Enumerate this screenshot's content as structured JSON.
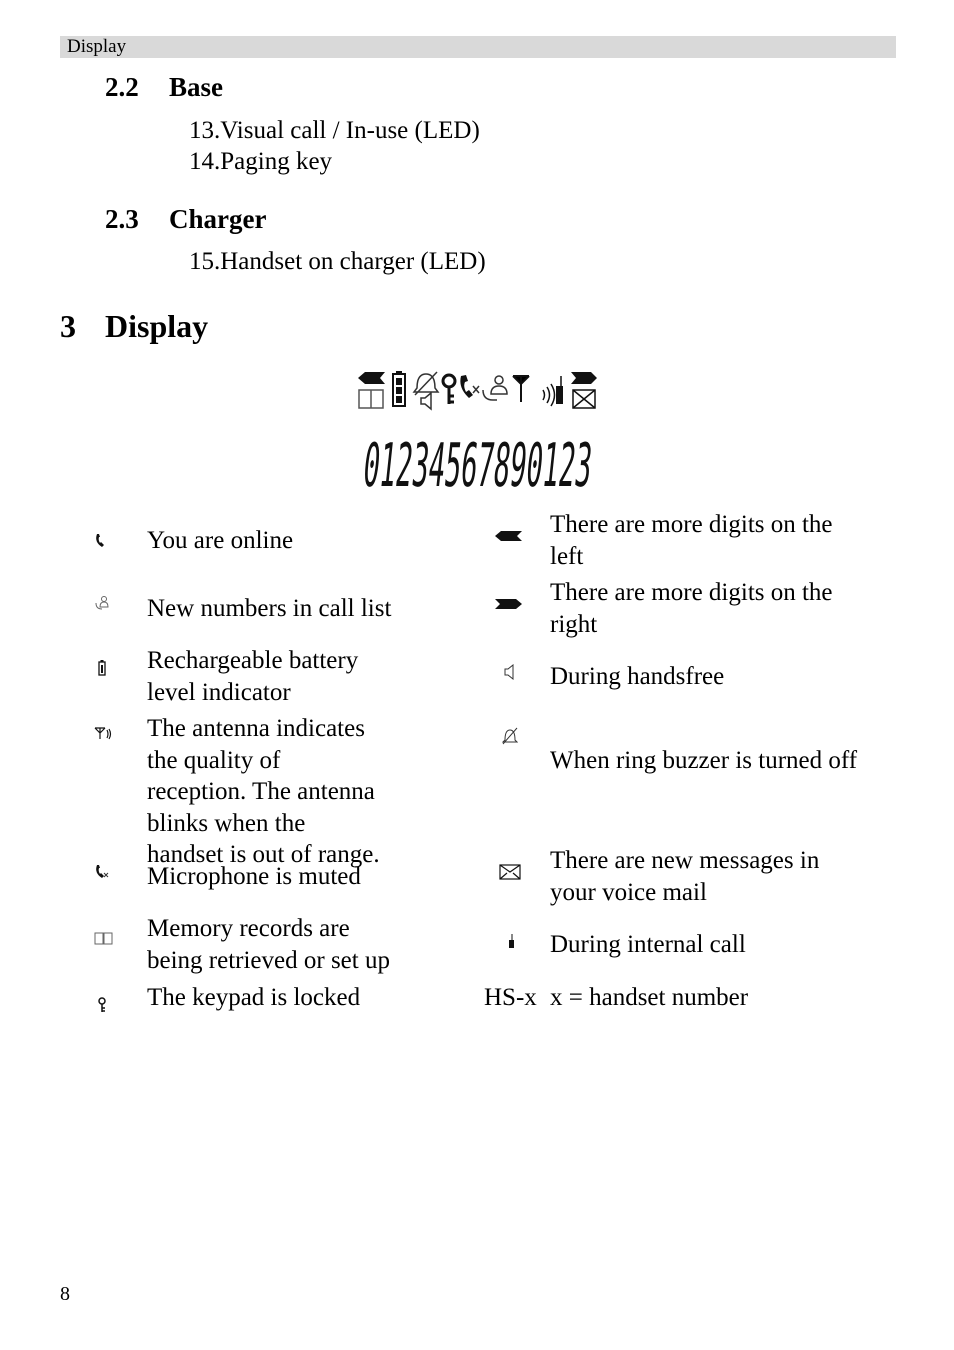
{
  "header": {
    "label": "Display"
  },
  "sections": [
    {
      "number": "2.2",
      "title": "Base",
      "items": [
        "13.Visual call / In-use (LED)",
        "14.Paging key"
      ]
    },
    {
      "number": "2.3",
      "title": "Charger",
      "items": [
        "15.Handset on charger (LED)"
      ]
    }
  ],
  "chapter": {
    "number": "3",
    "title": "Display"
  },
  "lcd": {
    "digits": "01234567890123",
    "icons": [
      "arrow-left-icon",
      "phonebook-icon",
      "battery-icon",
      "ringer-off-icon",
      "speaker-icon",
      "key-icon",
      "mute-icon",
      "call-list-icon",
      "antenna-icon",
      "intercom-icon",
      "arrow-right-icon",
      "envelope-icon"
    ]
  },
  "legend": {
    "left": [
      {
        "icon": "phone-online-icon",
        "text": "You are online"
      },
      {
        "icon": "call-list-icon",
        "text": "New numbers in call list"
      },
      {
        "icon": "battery-icon",
        "text": "Rechargeable battery level indicator"
      },
      {
        "icon": "antenna-icon",
        "text": "The antenna indicates the quality of reception. The antenna blinks when the handset is out of range."
      },
      {
        "icon": "mute-icon",
        "text": "Microphone is muted"
      },
      {
        "icon": "phonebook-icon",
        "text": "Memory records are being retrieved or set up"
      },
      {
        "icon": "key-icon",
        "text": "The keypad is locked"
      }
    ],
    "right": [
      {
        "icon": "arrow-left-icon",
        "text": "There are more digits on the left"
      },
      {
        "icon": "arrow-right-icon",
        "text": "There are more digits on the right"
      },
      {
        "icon": "speaker-icon",
        "text": "During handsfree"
      },
      {
        "icon": "ringer-off-icon",
        "text": "When ring buzzer is turned off"
      },
      {
        "icon": "envelope-icon",
        "text": "There are new messages in your voice mail"
      },
      {
        "icon": "intercom-icon",
        "text": "During internal call"
      },
      {
        "label": "HS-x",
        "text": "x = handset number"
      }
    ]
  },
  "footer": {
    "page_number": "8"
  }
}
